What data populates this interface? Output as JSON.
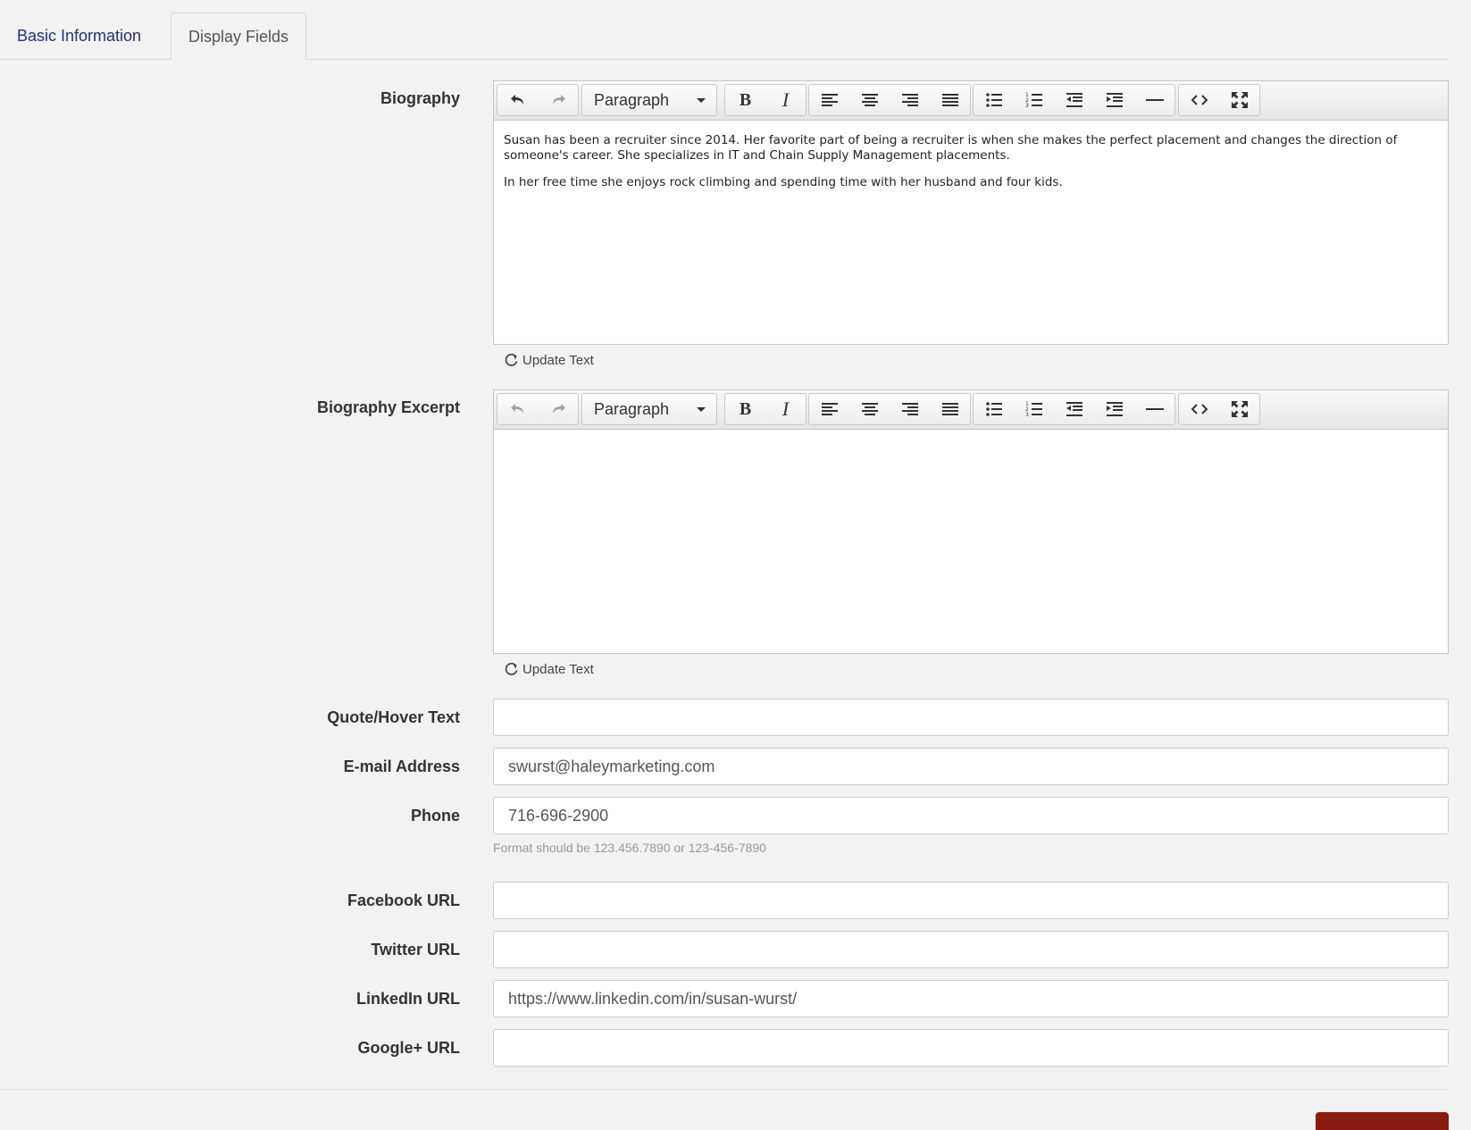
{
  "tabs": [
    {
      "label": "Basic Information"
    },
    {
      "label": "Display Fields"
    }
  ],
  "toolbar": {
    "format_label": "Paragraph",
    "buttons": [
      "undo-icon",
      "redo-icon",
      "bold-icon",
      "italic-icon",
      "align-left-icon",
      "align-center-icon",
      "align-right-icon",
      "align-justify-icon",
      "bullet-list-icon",
      "numbered-list-icon",
      "outdent-icon",
      "indent-icon",
      "horizontal-rule-icon",
      "source-code-icon",
      "fullscreen-icon"
    ]
  },
  "biography": {
    "label": "Biography",
    "paragraphs": [
      "Susan has been a recruiter since 2014. Her favorite part of being a recruiter is when she makes the perfect placement and changes the direction of someone's career. She specializes in IT and Chain Supply Management placements.",
      "In her free time she enjoys rock climbing and spending time with her husband and four kids."
    ],
    "update_label": "Update Text"
  },
  "excerpt": {
    "label": "Biography Excerpt",
    "update_label": "Update Text"
  },
  "fields": {
    "quote": {
      "label": "Quote/Hover Text",
      "value": ""
    },
    "email": {
      "label": "E-mail Address",
      "value": "swurst@haleymarketing.com"
    },
    "phone": {
      "label": "Phone",
      "value": "716-696-2900",
      "help": "Format should be 123.456.7890 or 123-456-7890"
    },
    "facebook": {
      "label": "Facebook URL",
      "value": ""
    },
    "twitter": {
      "label": "Twitter URL",
      "value": ""
    },
    "linkedin": {
      "label": "LinkedIn URL",
      "value": "https://www.linkedin.com/in/susan-wurst/"
    },
    "google": {
      "label": "Google+ URL",
      "value": ""
    }
  },
  "colors": {
    "tab_active_text": "#2a2d7c",
    "save_button": "#8b1a10"
  }
}
